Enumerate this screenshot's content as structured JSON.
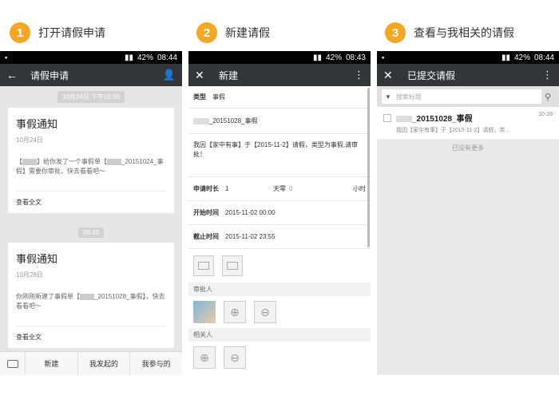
{
  "steps": [
    {
      "num": "1",
      "title": "打开请假申请"
    },
    {
      "num": "2",
      "title": "新建请假"
    },
    {
      "num": "3",
      "title": "查看与我相关的请假"
    }
  ],
  "status": {
    "battery": "42%",
    "time1": "08:44",
    "time2": "08:43",
    "time3": "08:44"
  },
  "phone1": {
    "title": "请假申请",
    "timestamp1": "10月24日 下午15:59",
    "card1": {
      "title": "事假通知",
      "date": "10月24日",
      "body_pre": "【",
      "body_post": "】给你发了一个事假单【",
      "body_end": "_20151024_事假】需要你审批，快去看看吧～",
      "view": "查看全文"
    },
    "timestamp2": "08:43",
    "card2": {
      "title": "事假通知",
      "date": "10月28日",
      "body_pre": "你刚刚新建了事假单【",
      "body_end": "_20151028_事假】，快去看看吧～",
      "view": "查看全文"
    },
    "tabs": [
      "新建",
      "我发起的",
      "我参与的"
    ]
  },
  "phone2": {
    "title": "新建",
    "type_label": "类型",
    "type_value": "事假",
    "name_value": "_20151028_事假",
    "reason": "我因【家中有事】于【2015-11-2】请假，类型为事假,请审批！",
    "duration_label": "申请时长",
    "duration_value": "1",
    "day_label": "天零",
    "day_value": "0",
    "hour_label": "小时",
    "start_label": "开始时间",
    "start_value": "2015-11-02 00:00",
    "end_label": "截止时间",
    "end_value": "2015-11-02 23:55",
    "approver_label": "审批人",
    "related_label": "相关人"
  },
  "phone3": {
    "title": "已提交请假",
    "search_placeholder": "搜索标题",
    "item": {
      "title": "_20151028_事假",
      "summary": "我因【家中有事】于【2015-11-2】请假，类...",
      "time": "10-28"
    },
    "no_more": "已没有更多"
  },
  "colors": {
    "accent": "#f5a623",
    "appbar": "#333638"
  }
}
